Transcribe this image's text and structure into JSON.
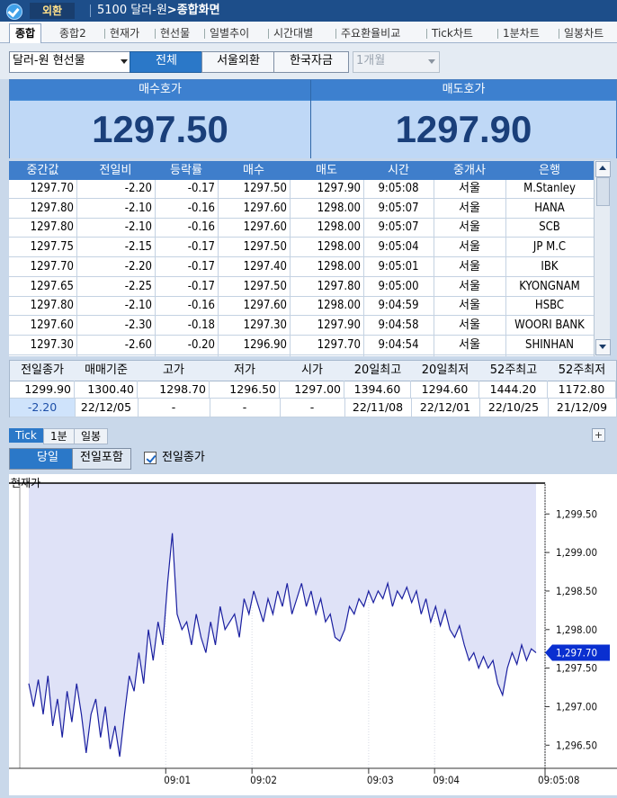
{
  "titlebar": {
    "badge": "외환",
    "screen_no": "5100 달러-원",
    "arrow": ">",
    "screen_name": "종합화면"
  },
  "tabs": [
    "종합",
    "종합2",
    "현재가",
    "현선물",
    "일별추이",
    "시간대별",
    "주요환율비교",
    "Tick차트",
    "1분차트",
    "일봉차트"
  ],
  "controls": {
    "instrument": "달러-원 현선물",
    "seg1": "전체",
    "seg2": "서울외환",
    "seg3": "한국자금",
    "period": "1개월"
  },
  "quote": {
    "bid_label": "매수호가",
    "bid": "1297.50",
    "ask_label": "매도호가",
    "ask": "1297.90"
  },
  "table": {
    "headers": [
      "중간값",
      "전일비",
      "등락률",
      "매수",
      "매도",
      "시간",
      "중개사",
      "은행"
    ],
    "rows": [
      [
        "1297.70",
        "-2.20",
        "-0.17",
        "1297.50",
        "1297.90",
        "9:05:08",
        "서울",
        "M.Stanley"
      ],
      [
        "1297.80",
        "-2.10",
        "-0.16",
        "1297.60",
        "1298.00",
        "9:05:07",
        "서울",
        "HANA"
      ],
      [
        "1297.80",
        "-2.10",
        "-0.16",
        "1297.60",
        "1298.00",
        "9:05:07",
        "서울",
        "SCB"
      ],
      [
        "1297.75",
        "-2.15",
        "-0.17",
        "1297.50",
        "1298.00",
        "9:05:04",
        "서울",
        "JP M.C"
      ],
      [
        "1297.70",
        "-2.20",
        "-0.17",
        "1297.40",
        "1298.00",
        "9:05:01",
        "서울",
        "IBK"
      ],
      [
        "1297.65",
        "-2.25",
        "-0.17",
        "1297.50",
        "1297.80",
        "9:05:00",
        "서울",
        "KYONGNAM"
      ],
      [
        "1297.80",
        "-2.10",
        "-0.16",
        "1297.60",
        "1298.00",
        "9:04:59",
        "서울",
        "HSBC"
      ],
      [
        "1297.60",
        "-2.30",
        "-0.18",
        "1297.30",
        "1297.90",
        "9:04:58",
        "서울",
        "WOORI BANK"
      ],
      [
        "1297.30",
        "-2.60",
        "-0.20",
        "1296.90",
        "1297.70",
        "9:04:54",
        "서울",
        "SHINHAN"
      ]
    ]
  },
  "summary": {
    "headers": [
      "전일종가",
      "매매기준",
      "고가",
      "저가",
      "시가",
      "20일최고",
      "20일최저",
      "52주최고",
      "52주최저"
    ],
    "values": [
      "1299.90",
      "1300.40",
      "1298.70",
      "1296.50",
      "1297.00",
      "1394.60",
      "1294.60",
      "1444.20",
      "1172.80"
    ],
    "sub": [
      "-2.20",
      "22/12/05",
      "-",
      "-",
      "-",
      "22/11/08",
      "22/12/01",
      "22/10/25",
      "21/12/09"
    ]
  },
  "chart_tabs": [
    "Tick",
    "1분",
    "일봉"
  ],
  "chart_opts": {
    "today": "당일",
    "incl_prev": "전일포함",
    "prev_close_check": "전일종가",
    "plus": "+"
  },
  "colors": {
    "accent": "#2b78c8",
    "header": "#3f7ecb",
    "line": "#1a1fa0",
    "fill": "#dfe2f7",
    "marker": "#0a2fd0"
  },
  "chart_data": {
    "type": "line",
    "title": "현재가",
    "x_ticks": [
      "09:01",
      "09:02",
      "09:03",
      "09:04",
      "09:05:08"
    ],
    "y_ticks": [
      "1,299.50",
      "1,299.00",
      "1,298.50",
      "1,298.00",
      "1,297.50",
      "1,297.00",
      "1,296.50"
    ],
    "ylim": [
      1296.2,
      1299.9
    ],
    "reference_line": 1299.9,
    "current": "1,297.70",
    "series": [
      {
        "values": [
          1297.3,
          1297.0,
          1297.35,
          1296.9,
          1297.4,
          1296.75,
          1297.1,
          1296.6,
          1297.2,
          1296.8,
          1297.3,
          1296.9,
          1296.4,
          1296.9,
          1297.1,
          1296.6,
          1297.0,
          1296.45,
          1296.75,
          1296.35,
          1296.9,
          1297.4,
          1297.2,
          1297.7,
          1297.3,
          1298.0,
          1297.6,
          1298.1,
          1297.8,
          1298.6,
          1299.25,
          1298.2,
          1298.0,
          1298.1,
          1297.8,
          1298.2,
          1297.9,
          1297.7,
          1298.1,
          1297.8,
          1298.3,
          1298.0,
          1298.1,
          1298.2,
          1297.9,
          1298.4,
          1298.2,
          1298.5,
          1298.3,
          1298.1,
          1298.4,
          1298.2,
          1298.5,
          1298.3,
          1298.6,
          1298.2,
          1298.4,
          1298.6,
          1298.3,
          1298.5,
          1298.2,
          1298.4,
          1298.1,
          1298.2,
          1297.9,
          1297.85,
          1298.0,
          1298.3,
          1298.2,
          1298.4,
          1298.3,
          1298.5,
          1298.35,
          1298.5,
          1298.4,
          1298.6,
          1298.3,
          1298.5,
          1298.4,
          1298.55,
          1298.35,
          1298.5,
          1298.2,
          1298.4,
          1298.1,
          1298.3,
          1298.05,
          1298.25,
          1298.0,
          1297.9,
          1298.05,
          1297.8,
          1297.6,
          1297.7,
          1297.5,
          1297.65,
          1297.5,
          1297.6,
          1297.3,
          1297.15,
          1297.5,
          1297.7,
          1297.55,
          1297.8,
          1297.6,
          1297.75,
          1297.7
        ]
      }
    ]
  }
}
